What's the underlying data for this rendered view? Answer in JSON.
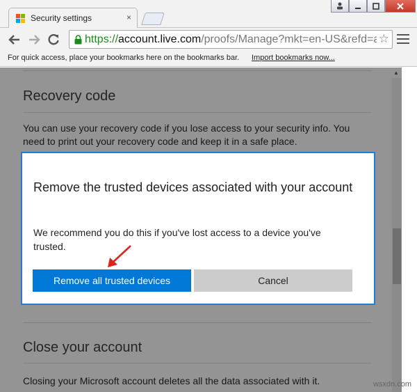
{
  "browser": {
    "tab_title": "Security settings",
    "tab_close_glyph": "×",
    "url_scheme": "https://",
    "url_host": "account.live.com",
    "url_path": "/proofs/Manage?mkt=en-US&refd=ac",
    "bookmarks_hint": "For quick access, place your bookmarks here on the bookmarks bar.",
    "import_link": "Import bookmarks now...",
    "star_glyph": "☆"
  },
  "page": {
    "recovery_title": "Recovery code",
    "recovery_text": "You can use your recovery code if you lose access to your security info. You need to print out your recovery code and keep it in a safe place.",
    "close_title": "Close your account",
    "close_text": "Closing your Microsoft account deletes all the data associated with it."
  },
  "dialog": {
    "title": "Remove the trusted devices associated with your account",
    "body": "We recommend you do this if you've lost access to a device you've trusted.",
    "primary_button": "Remove all trusted devices",
    "secondary_button": "Cancel"
  },
  "watermark": "wsxdn.com",
  "colors": {
    "accent": "#0078d7",
    "dialog_border": "#1d7ed4",
    "secure_scheme": "#1b8b1b",
    "annotation_arrow": "#d9261c"
  },
  "icons": [
    "windows-logo-icon",
    "close-icon",
    "user-icon",
    "minimize-icon",
    "maximize-icon",
    "back-arrow-icon",
    "forward-arrow-icon",
    "reload-icon",
    "lock-icon",
    "star-icon",
    "menu-icon",
    "red-arrow-icon"
  ]
}
